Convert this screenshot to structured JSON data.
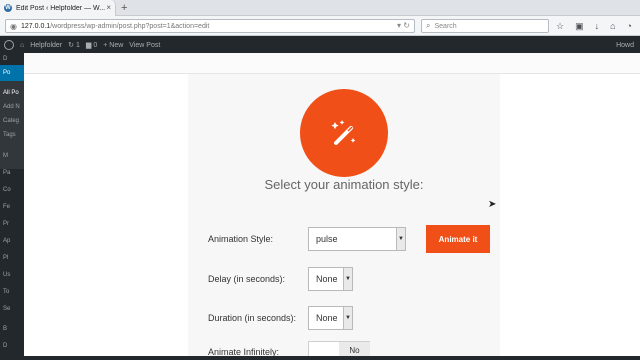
{
  "browser": {
    "tab_title": "Edit Post ‹ Helpfolder — W...",
    "tab_close": "×",
    "new_tab": "+",
    "url_host": "127.0.0.1",
    "url_path": "/wordpress/wp-admin/post.php?post=1&action=edit",
    "search_placeholder": "Search",
    "toolbar_icons": [
      "star-icon",
      "bookmarks-icon",
      "download-icon",
      "home-icon",
      "chat-icon",
      "menu-icon"
    ]
  },
  "adminbar": {
    "site_name": "Helpfolder",
    "updates_count": "1",
    "comments_count": "0",
    "new_label": "+ New",
    "view_post": "View Post",
    "howdy": "Howd"
  },
  "sidebar": {
    "items": [
      "D",
      "Po",
      "All Po",
      "Add N",
      "Categ",
      "Tags",
      "M",
      "Pa",
      "Co",
      "Fe",
      "Pr",
      "Ap",
      "Pl",
      "Us",
      "To",
      "Se",
      "B",
      "D"
    ]
  },
  "modal": {
    "heading": "Select your animation style:",
    "animation_style_label": "Animation Style:",
    "animation_style_value": "pulse",
    "animate_button": "Animate it",
    "delay_label": "Delay (in seconds):",
    "delay_value": "None",
    "duration_label": "Duration (in seconds):",
    "duration_value": "None",
    "infinite_label": "Animate Infinitely:",
    "infinite_value": "No"
  },
  "colors": {
    "accent": "#f04f17",
    "wp_dark": "#23282d",
    "wp_blue": "#0073aa"
  }
}
